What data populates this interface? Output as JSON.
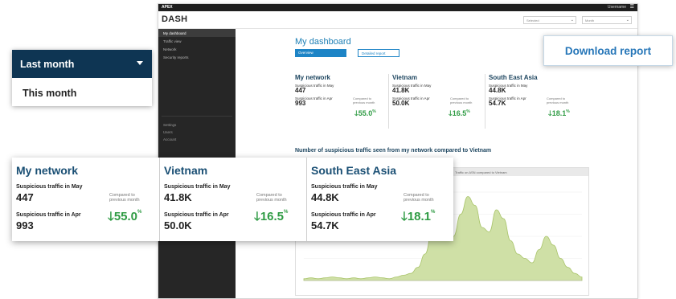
{
  "app": {
    "brand": "APEX",
    "user": "Username",
    "logo": "DASH",
    "filter_a": "Selected",
    "filter_b": "Month",
    "chevron": "⌄",
    "menu_icon": "☰"
  },
  "sidebar": {
    "items": [
      {
        "label": "My dashboard",
        "active": true
      },
      {
        "label": "Traffic view"
      },
      {
        "label": "Network"
      },
      {
        "label": "Security reports"
      }
    ],
    "section": "Settings",
    "sub_items": [
      "Users",
      "Account"
    ]
  },
  "main": {
    "title": "My dashboard",
    "btn_primary": "Overview",
    "btn_secondary": "Detailed report",
    "chart_title": "Number of suspicious traffic seen from my network compared to Vietnam",
    "chart_caption": "Traffic on ASN compared to Vietnam"
  },
  "period_dropdown": {
    "selected": "Last month",
    "option": "This month"
  },
  "download_button": "Download report",
  "cards": [
    {
      "title": "My network",
      "label_may": "Suspicious traffic in May",
      "value_may": "447",
      "label_apr": "Suspicious traffic in Apr",
      "value_apr": "993",
      "compare": "Compared to previous month",
      "arrow": "🡓",
      "percent": "55.0",
      "unit": "%"
    },
    {
      "title": "Vietnam",
      "label_may": "Suspicious traffic in May",
      "value_may": "41.8K",
      "label_apr": "Suspicious traffic in Apr",
      "value_apr": "50.0K",
      "compare": "Compared to previous month",
      "arrow": "🡓",
      "percent": "16.5",
      "unit": "%"
    },
    {
      "title": "South East Asia",
      "label_may": "Suspicious traffic in May",
      "value_may": "44.8K",
      "label_apr": "Suspicious traffic in Apr",
      "value_apr": "54.7K",
      "compare": "Compared to previous month",
      "arrow": "🡓",
      "percent": "18.1",
      "unit": "%"
    }
  ],
  "colors": {
    "navy": "#0e3553",
    "accent_blue": "#2676b8",
    "positive_green": "#2e9b43",
    "area_fill": "#cfe0a6",
    "area_stroke": "#a9c46a"
  },
  "chart_data": {
    "type": "area",
    "series": [
      {
        "values": [
          2,
          3,
          2,
          3,
          4,
          3,
          2,
          3,
          2,
          3,
          4,
          3,
          2,
          4,
          6,
          8,
          15,
          30,
          55,
          70,
          60,
          50,
          75,
          95,
          85,
          60,
          55,
          80,
          70,
          45,
          30,
          25,
          20,
          35,
          50,
          40,
          25,
          15,
          8,
          4
        ]
      }
    ]
  }
}
